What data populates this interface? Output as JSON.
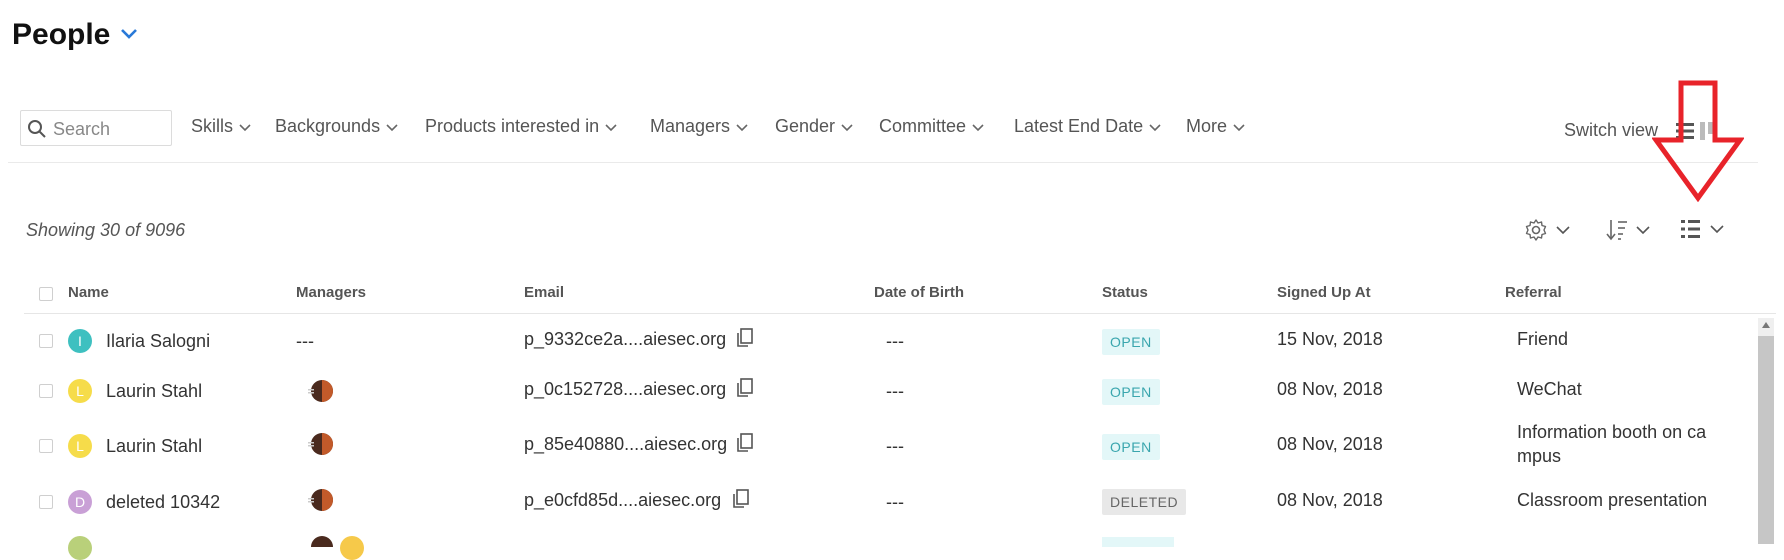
{
  "page": {
    "title": "People"
  },
  "search": {
    "placeholder": "Search"
  },
  "filters": [
    "Skills",
    "Backgrounds",
    "Products interested in",
    "Managers",
    "Gender",
    "Committee",
    "Latest End Date",
    "More"
  ],
  "switch_view": {
    "label": "Switch view"
  },
  "summary": {
    "showing": "Showing 30 of 9096"
  },
  "table": {
    "columns": [
      "Name",
      "Managers",
      "Email",
      "Date of Birth",
      "Status",
      "Signed Up At",
      "Referral"
    ],
    "rows": [
      {
        "initial": "I",
        "avatar_color": "#3ec0c0",
        "name": "Ilaria Salogni",
        "managers": "---",
        "email": "p_9332ce2a....aiesec.org",
        "dob": "---",
        "status": "OPEN",
        "signed_up": "15 Nov, 2018",
        "referral": "Friend"
      },
      {
        "initial": "L",
        "avatar_color": "#f6dc4a",
        "name": "Laurin Stahl",
        "managers": "",
        "email": "p_0c152728....aiesec.org",
        "dob": "---",
        "status": "OPEN",
        "signed_up": "08 Nov, 2018",
        "referral": "WeChat"
      },
      {
        "initial": "L",
        "avatar_color": "#f6dc4a",
        "name": "Laurin Stahl",
        "managers": "",
        "email": "p_85e40880....aiesec.org",
        "dob": "---",
        "status": "OPEN",
        "signed_up": "08 Nov, 2018",
        "referral_line1": "Information booth on ca",
        "referral_line2": "mpus"
      },
      {
        "initial": "D",
        "avatar_color": "#c9a0d6",
        "name": "deleted 10342",
        "managers": "",
        "email": "p_e0cfd85d....aiesec.org",
        "dob": "---",
        "status": "DELETED",
        "signed_up": "08 Nov, 2018",
        "referral": "Classroom presentation"
      }
    ]
  },
  "colors": {
    "accent_blue": "#2979d8",
    "open_badge_bg": "#e3f7f8",
    "open_badge_text": "#3aa6ae",
    "deleted_badge_bg": "#e8e8e8",
    "deleted_badge_text": "#666666",
    "annotation_arrow": "#e8232a"
  },
  "icons": [
    "chevron-down-icon",
    "search-icon",
    "list-view-icon",
    "board-view-icon",
    "settings-gear-icon",
    "sort-icon",
    "columns-icon",
    "copy-icon",
    "down-arrow-annotation"
  ]
}
